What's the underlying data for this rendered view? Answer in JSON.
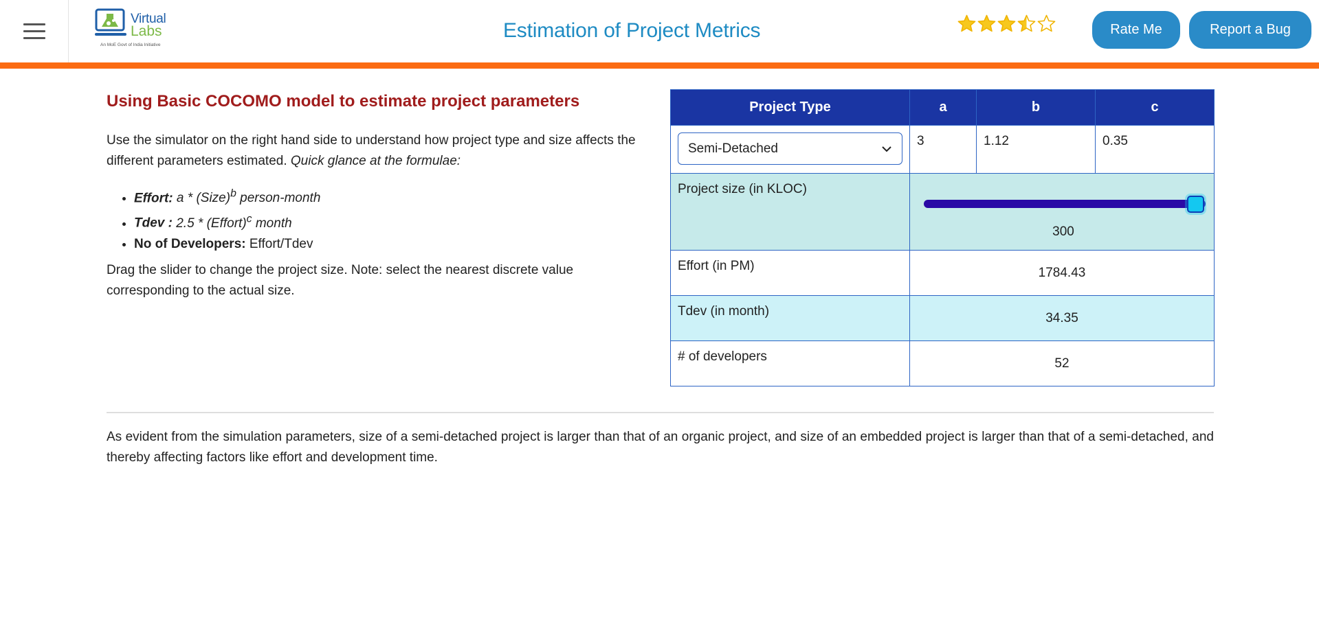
{
  "header": {
    "logo_line1": "Virtual",
    "logo_line2": "Labs",
    "logo_tagline": "An MoE Govt of India Initiative",
    "title": "Estimation of Project Metrics",
    "rating": 3.5,
    "rating_max": 5,
    "rate_button": "Rate Me",
    "bug_button": "Report a Bug",
    "accent_color": "#fb6b12"
  },
  "left": {
    "heading": "Using Basic COCOMO model to estimate project parameters",
    "intro": "Use the simulator on the right hand side to understand how project type and size affects the different parameters estimated.",
    "intro_italic": "Quick glance at the formulae:",
    "formulas": [
      {
        "label": "Effort:",
        "expr": "a * (Size)",
        "sup": "b",
        "tail": "person-month"
      },
      {
        "label": "Tdev :",
        "expr": "2.5 * (Effort)",
        "sup": "c",
        "tail": "month"
      },
      {
        "label": "No of Developers:",
        "expr": "Effort/Tdev"
      }
    ],
    "note": "Drag the slider to change the project size. Note: select the nearest discrete value corresponding to the actual size."
  },
  "simulator": {
    "headers": [
      "Project Type",
      "a",
      "b",
      "c"
    ],
    "project_type": "Semi-Detached",
    "a": "3",
    "b": "1.12",
    "c": "0.35",
    "size_label": "Project size (in KLOC)",
    "size_value": "300",
    "slider_fraction": 1.0,
    "effort_label": "Effort (in PM)",
    "effort_value": "1784.43",
    "tdev_label": "Tdev (in month)",
    "tdev_value": "34.35",
    "devs_label": "# of developers",
    "devs_value": "52"
  },
  "conclusion": "As evident from the simulation parameters, size of a semi-detached project is larger than that of an organic project, and size of an embedded project is larger than that of a semi-detached, and thereby affecting factors like effort and development time."
}
